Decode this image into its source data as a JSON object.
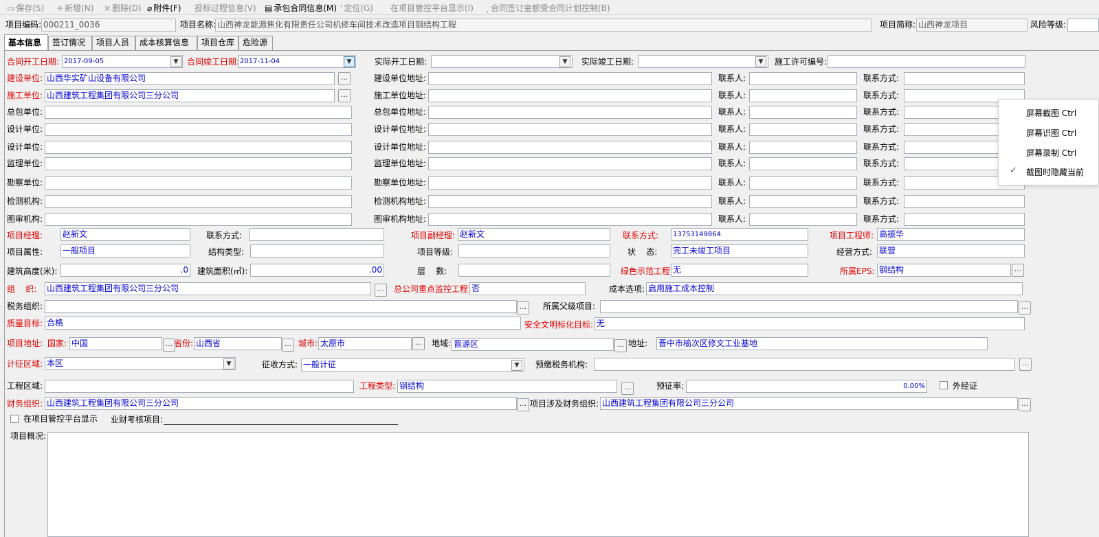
{
  "toolbar": {
    "save": "保存(S)",
    "add": "新增(N)",
    "delete": "删除(D)",
    "attachment": "附件(F)",
    "bid_process": "投标过程信息(V)",
    "contract_info": "承包合同信息(M)",
    "locate": "定位(G)",
    "show_platform": "在项目管控平台显示(I)",
    "contract_amount": "合同签订金额受合同计划控制(B)"
  },
  "header": {
    "project_code_label": "项目编码:",
    "project_code": "000211_0036",
    "project_name_label": "项目名称:",
    "project_name": "山西神龙能源焦化有限责任公司机修车间技术改造项目钢结构工程",
    "project_short_label": "项目简称:",
    "project_short": "山西神龙项目",
    "risk_level_label": "风险等级:"
  },
  "tabs": [
    "基本信息",
    "签订情况",
    "项目人员",
    "成本核算信息",
    "项目仓库",
    "危险源"
  ],
  "dates": {
    "contract_start_label": "合同开工日期:",
    "contract_start": "2017-09-05",
    "contract_end_label": "合同竣工日期:",
    "contract_end": "2017-11-04",
    "actual_start_label": "实际开工日期:",
    "actual_end_label": "实际竣工日期:",
    "permit_label": "施工许可编号:"
  },
  "units": [
    {
      "label": "建设单位:",
      "value": "山西华实矿山设备有限公司",
      "addr_label": "建设单位地址:",
      "red": true
    },
    {
      "label": "施工单位:",
      "value": "山西建筑工程集团有限公司三分公司",
      "addr_label": "施工单位地址:",
      "red": true
    },
    {
      "label": "总包单位:",
      "value": "",
      "addr_label": "总包单位地址:",
      "red": false
    },
    {
      "label": "设计单位:",
      "value": "",
      "addr_label": "设计单位地址:",
      "red": false
    },
    {
      "label": "设计单位:",
      "value": "",
      "addr_label": "设计单位地址:",
      "red": false
    },
    {
      "label": "监理单位:",
      "value": "",
      "addr_label": "监理单位地址:",
      "red": false
    },
    {
      "label": "勘察单位:",
      "value": "",
      "addr_label": "勘察单位地址:",
      "red": false
    },
    {
      "label": "检测机构:",
      "value": "",
      "addr_label": "检测机构地址:",
      "red": false
    },
    {
      "label": "图审机构:",
      "value": "",
      "addr_label": "图审机构地址:",
      "red": false
    }
  ],
  "contact_person_label": "联系人:",
  "contact_method_label": "联系方式:",
  "people": {
    "pm_label": "项目经理:",
    "pm": "赵新文",
    "pm_contact_label": "联系方式:",
    "deputy_label": "项目副经理:",
    "deputy": "赵新文",
    "deputy_contact_label": "联系方式:",
    "deputy_contact": "13753149864",
    "engineer_label": "项目工程师:",
    "engineer": "高振华"
  },
  "attrs": {
    "property_label": "项目属性:",
    "property": "一般项目",
    "structure_label": "结构类型:",
    "grade_label": "项目等级:",
    "status_label": "状    态:",
    "status": "完工未竣工项目",
    "mode_label": "经营方式:",
    "mode": "联营"
  },
  "building": {
    "height_label": "建筑高度(米):",
    "height": ".0",
    "area_label": "建筑面积(㎡):",
    "area": ".00",
    "floors_label": "层    数:",
    "green_label": "绿色示范工程:",
    "green": "无",
    "eps_label": "所属EPS:",
    "eps": "钢结构"
  },
  "org": {
    "org_label": "组    织:",
    "org": "山西建筑工程集团有限公司三分公司",
    "key_label": "总公司重点监控工程",
    "key": "否",
    "cost_label": "成本选项:",
    "cost": "启用施工成本控制",
    "tax_org_label": "税务组织:",
    "parent_label": "所属父级项目:",
    "quality_label": "质量目标:",
    "quality": "合格",
    "safety_label": "安全文明标化目标:",
    "safety": "无"
  },
  "address": {
    "label": "项目地址:",
    "country_label": "国家:",
    "country": "中国",
    "province_label": "省份:",
    "province": "山西省",
    "city_label": "城市:",
    "city": "太原市",
    "region_label": "地域:",
    "region": "晋源区",
    "addr_label": "地址:",
    "addr": "晋中市榆次区修文工业基地"
  },
  "tax": {
    "area_label": "计征区域:",
    "area": "本区",
    "method_label": "征收方式:",
    "method": "一般计征",
    "prepay_label": "预缴税务机构:"
  },
  "engineering": {
    "area_label": "工程区域:",
    "type_label": "工程类型:",
    "type": "钢结构",
    "rate_label": "预征率:",
    "rate": "0.00%",
    "external_label": "外经证"
  },
  "finance": {
    "org_label": "财务组织:",
    "org": "山西建筑工程集团有限公司三分公司",
    "related_label": "项目涉及财务组织:",
    "related": "山西建筑工程集团有限公司三分公司",
    "platform_label": "在项目管控平台显示",
    "assess_label": "业财考核项目:"
  },
  "overview_label": "项目概况:",
  "context_menu": {
    "items": [
      "屏幕截图 Ctrl",
      "屏幕识图 Ctrl",
      "屏幕录制 Ctrl",
      "截图时隐藏当前"
    ]
  },
  "colors": {
    "label_red": "#e00000",
    "value_blue": "#0000d0"
  }
}
